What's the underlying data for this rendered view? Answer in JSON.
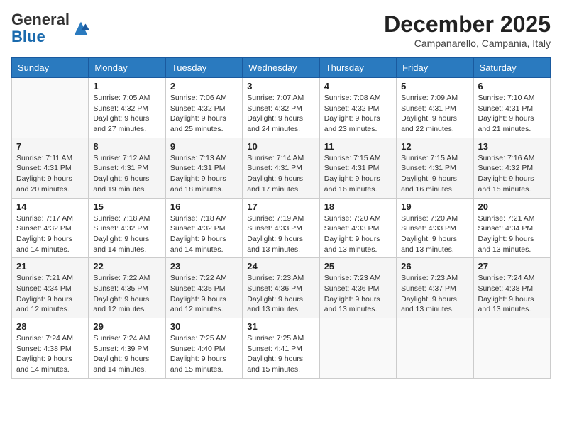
{
  "header": {
    "logo_general": "General",
    "logo_blue": "Blue",
    "month_year": "December 2025",
    "location": "Campanarello, Campania, Italy"
  },
  "days_of_week": [
    "Sunday",
    "Monday",
    "Tuesday",
    "Wednesday",
    "Thursday",
    "Friday",
    "Saturday"
  ],
  "weeks": [
    [
      {
        "day": "",
        "sunrise": "",
        "sunset": "",
        "daylight": ""
      },
      {
        "day": "1",
        "sunrise": "Sunrise: 7:05 AM",
        "sunset": "Sunset: 4:32 PM",
        "daylight": "Daylight: 9 hours and 27 minutes."
      },
      {
        "day": "2",
        "sunrise": "Sunrise: 7:06 AM",
        "sunset": "Sunset: 4:32 PM",
        "daylight": "Daylight: 9 hours and 25 minutes."
      },
      {
        "day": "3",
        "sunrise": "Sunrise: 7:07 AM",
        "sunset": "Sunset: 4:32 PM",
        "daylight": "Daylight: 9 hours and 24 minutes."
      },
      {
        "day": "4",
        "sunrise": "Sunrise: 7:08 AM",
        "sunset": "Sunset: 4:32 PM",
        "daylight": "Daylight: 9 hours and 23 minutes."
      },
      {
        "day": "5",
        "sunrise": "Sunrise: 7:09 AM",
        "sunset": "Sunset: 4:31 PM",
        "daylight": "Daylight: 9 hours and 22 minutes."
      },
      {
        "day": "6",
        "sunrise": "Sunrise: 7:10 AM",
        "sunset": "Sunset: 4:31 PM",
        "daylight": "Daylight: 9 hours and 21 minutes."
      }
    ],
    [
      {
        "day": "7",
        "sunrise": "Sunrise: 7:11 AM",
        "sunset": "Sunset: 4:31 PM",
        "daylight": "Daylight: 9 hours and 20 minutes."
      },
      {
        "day": "8",
        "sunrise": "Sunrise: 7:12 AM",
        "sunset": "Sunset: 4:31 PM",
        "daylight": "Daylight: 9 hours and 19 minutes."
      },
      {
        "day": "9",
        "sunrise": "Sunrise: 7:13 AM",
        "sunset": "Sunset: 4:31 PM",
        "daylight": "Daylight: 9 hours and 18 minutes."
      },
      {
        "day": "10",
        "sunrise": "Sunrise: 7:14 AM",
        "sunset": "Sunset: 4:31 PM",
        "daylight": "Daylight: 9 hours and 17 minutes."
      },
      {
        "day": "11",
        "sunrise": "Sunrise: 7:15 AM",
        "sunset": "Sunset: 4:31 PM",
        "daylight": "Daylight: 9 hours and 16 minutes."
      },
      {
        "day": "12",
        "sunrise": "Sunrise: 7:15 AM",
        "sunset": "Sunset: 4:31 PM",
        "daylight": "Daylight: 9 hours and 16 minutes."
      },
      {
        "day": "13",
        "sunrise": "Sunrise: 7:16 AM",
        "sunset": "Sunset: 4:32 PM",
        "daylight": "Daylight: 9 hours and 15 minutes."
      }
    ],
    [
      {
        "day": "14",
        "sunrise": "Sunrise: 7:17 AM",
        "sunset": "Sunset: 4:32 PM",
        "daylight": "Daylight: 9 hours and 14 minutes."
      },
      {
        "day": "15",
        "sunrise": "Sunrise: 7:18 AM",
        "sunset": "Sunset: 4:32 PM",
        "daylight": "Daylight: 9 hours and 14 minutes."
      },
      {
        "day": "16",
        "sunrise": "Sunrise: 7:18 AM",
        "sunset": "Sunset: 4:32 PM",
        "daylight": "Daylight: 9 hours and 14 minutes."
      },
      {
        "day": "17",
        "sunrise": "Sunrise: 7:19 AM",
        "sunset": "Sunset: 4:33 PM",
        "daylight": "Daylight: 9 hours and 13 minutes."
      },
      {
        "day": "18",
        "sunrise": "Sunrise: 7:20 AM",
        "sunset": "Sunset: 4:33 PM",
        "daylight": "Daylight: 9 hours and 13 minutes."
      },
      {
        "day": "19",
        "sunrise": "Sunrise: 7:20 AM",
        "sunset": "Sunset: 4:33 PM",
        "daylight": "Daylight: 9 hours and 13 minutes."
      },
      {
        "day": "20",
        "sunrise": "Sunrise: 7:21 AM",
        "sunset": "Sunset: 4:34 PM",
        "daylight": "Daylight: 9 hours and 13 minutes."
      }
    ],
    [
      {
        "day": "21",
        "sunrise": "Sunrise: 7:21 AM",
        "sunset": "Sunset: 4:34 PM",
        "daylight": "Daylight: 9 hours and 12 minutes."
      },
      {
        "day": "22",
        "sunrise": "Sunrise: 7:22 AM",
        "sunset": "Sunset: 4:35 PM",
        "daylight": "Daylight: 9 hours and 12 minutes."
      },
      {
        "day": "23",
        "sunrise": "Sunrise: 7:22 AM",
        "sunset": "Sunset: 4:35 PM",
        "daylight": "Daylight: 9 hours and 12 minutes."
      },
      {
        "day": "24",
        "sunrise": "Sunrise: 7:23 AM",
        "sunset": "Sunset: 4:36 PM",
        "daylight": "Daylight: 9 hours and 13 minutes."
      },
      {
        "day": "25",
        "sunrise": "Sunrise: 7:23 AM",
        "sunset": "Sunset: 4:36 PM",
        "daylight": "Daylight: 9 hours and 13 minutes."
      },
      {
        "day": "26",
        "sunrise": "Sunrise: 7:23 AM",
        "sunset": "Sunset: 4:37 PM",
        "daylight": "Daylight: 9 hours and 13 minutes."
      },
      {
        "day": "27",
        "sunrise": "Sunrise: 7:24 AM",
        "sunset": "Sunset: 4:38 PM",
        "daylight": "Daylight: 9 hours and 13 minutes."
      }
    ],
    [
      {
        "day": "28",
        "sunrise": "Sunrise: 7:24 AM",
        "sunset": "Sunset: 4:38 PM",
        "daylight": "Daylight: 9 hours and 14 minutes."
      },
      {
        "day": "29",
        "sunrise": "Sunrise: 7:24 AM",
        "sunset": "Sunset: 4:39 PM",
        "daylight": "Daylight: 9 hours and 14 minutes."
      },
      {
        "day": "30",
        "sunrise": "Sunrise: 7:25 AM",
        "sunset": "Sunset: 4:40 PM",
        "daylight": "Daylight: 9 hours and 15 minutes."
      },
      {
        "day": "31",
        "sunrise": "Sunrise: 7:25 AM",
        "sunset": "Sunset: 4:41 PM",
        "daylight": "Daylight: 9 hours and 15 minutes."
      },
      {
        "day": "",
        "sunrise": "",
        "sunset": "",
        "daylight": ""
      },
      {
        "day": "",
        "sunrise": "",
        "sunset": "",
        "daylight": ""
      },
      {
        "day": "",
        "sunrise": "",
        "sunset": "",
        "daylight": ""
      }
    ]
  ]
}
